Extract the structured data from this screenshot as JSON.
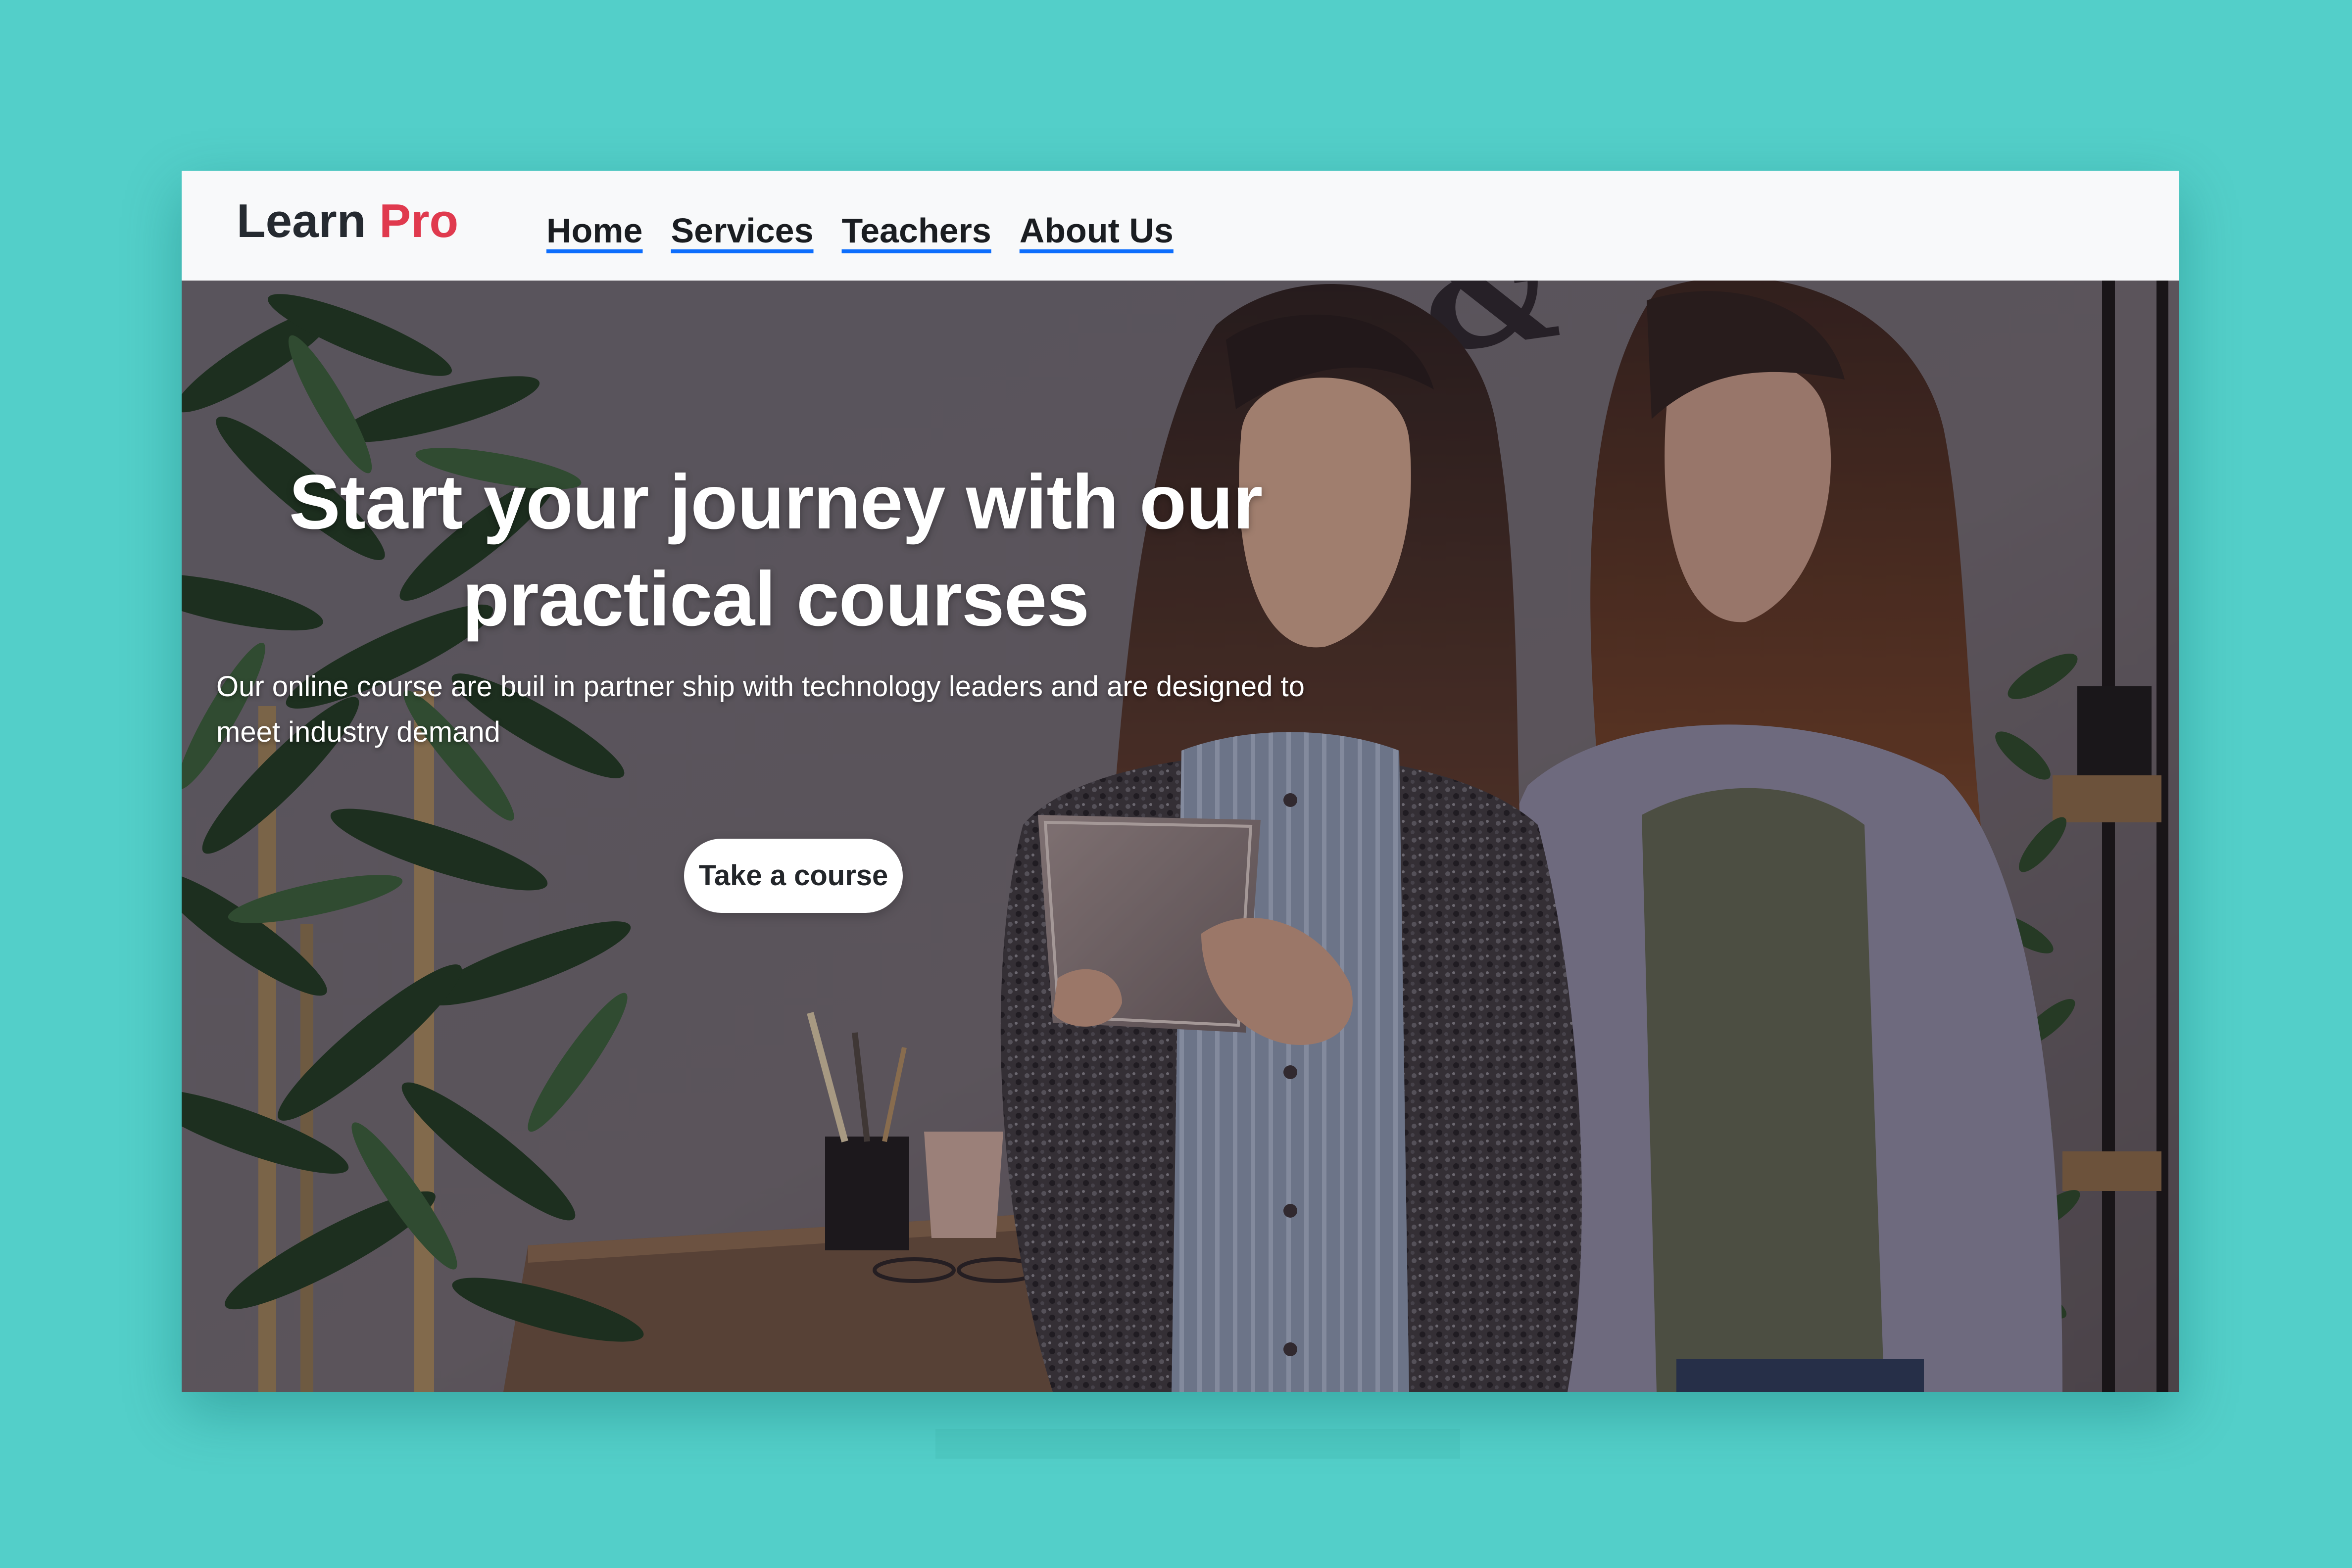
{
  "brand": {
    "name": "Learn",
    "accent": "Pro",
    "accent_color": "#e03a4e"
  },
  "nav": {
    "links": [
      "Home",
      "Services",
      "Teachers",
      "About Us"
    ],
    "underline_color": "#0d6efd"
  },
  "hero": {
    "title": "Start your journey with our practical courses",
    "description": "Our online course are buil in partner ship with technology leaders and are designed to meet industry demand",
    "cta_label": "Take a course",
    "image": "two-women-looking-at-tablet-photo"
  },
  "colors": {
    "backdrop": "#53cfc9",
    "navbar": "#f8f9fa",
    "text_dark": "#252a30",
    "hero_text": "#ffffff"
  }
}
